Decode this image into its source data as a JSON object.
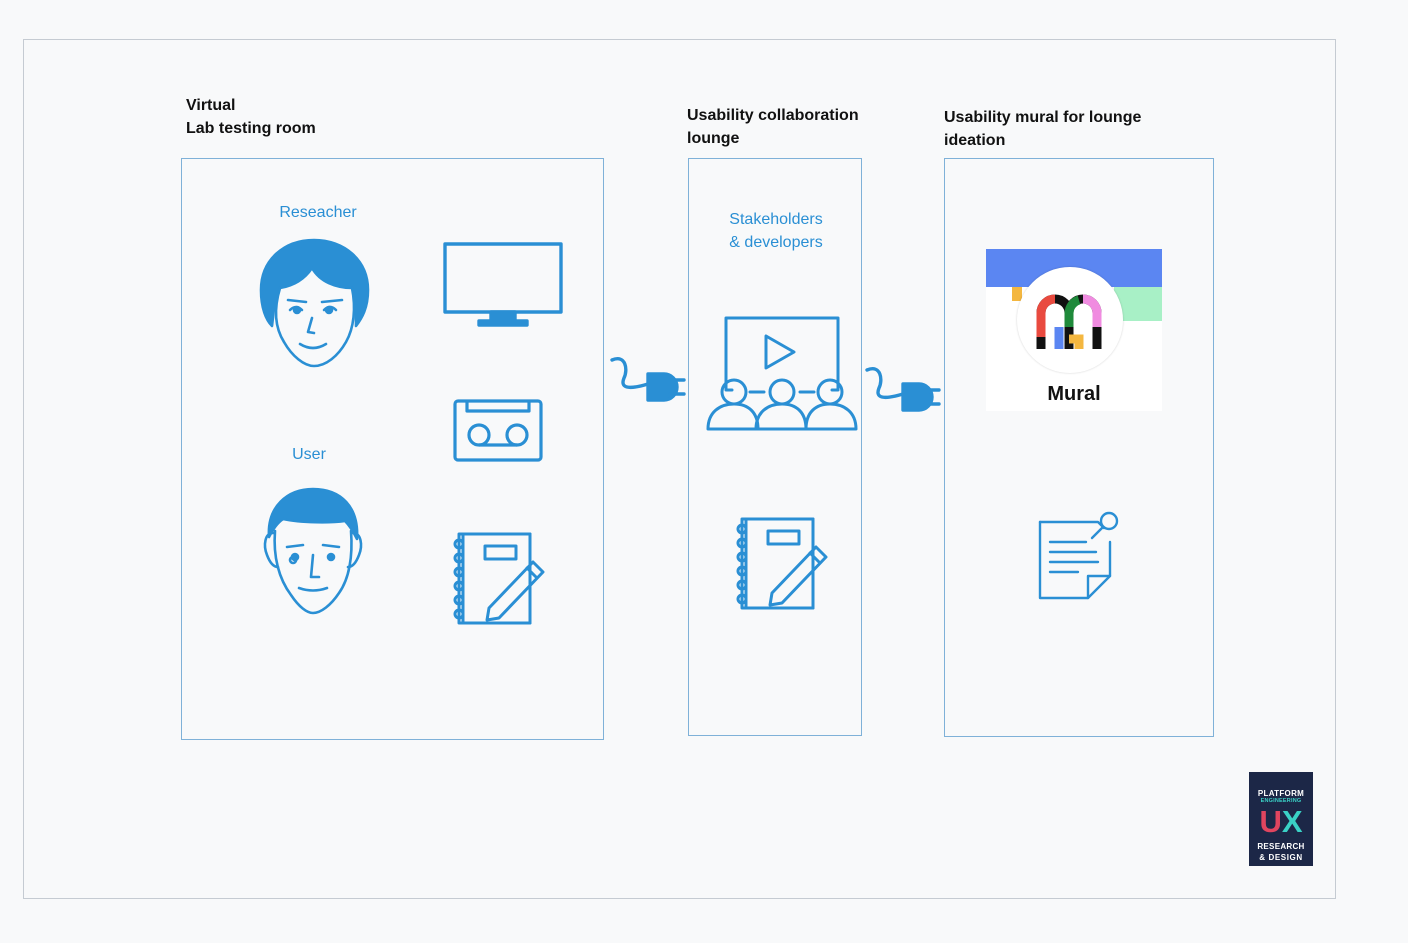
{
  "colors": {
    "icon_blue": "#2a8fd4",
    "panel_border": "#7fb1d8",
    "mural_top": "#5b86f2",
    "mural_accent": "#a8f0c6",
    "badge_bg": "#1c2747",
    "badge_u": "#e0455f",
    "badge_x": "#3ad1c6"
  },
  "sections": {
    "lab": {
      "title_line1": "Virtual",
      "title_line2": "Lab testing room",
      "researcher_label": "Reseacher",
      "user_label": "User"
    },
    "lounge": {
      "title_line1": "Usability collaboration",
      "title_line2": "lounge",
      "stakeholders_line1": "Stakeholders",
      "stakeholders_line2": "& developers"
    },
    "mural": {
      "title_line1": "Usability mural for lounge",
      "title_line2": "ideation",
      "brand_name": "Mural"
    }
  },
  "icons": {
    "researcher": "woman-face-icon",
    "user": "man-face-icon",
    "monitor": "monitor-icon",
    "cassette": "cassette-tape-icon",
    "notebook": "notebook-pencil-icon",
    "plug": "plug-connector-icon",
    "presentation": "video-presentation-audience-icon",
    "note": "sticky-note-pin-icon"
  },
  "logo": {
    "line1": "PLATFORM",
    "line2": "ENGINEERING",
    "mark_u": "U",
    "mark_x": "X",
    "line3": "RESEARCH",
    "line4": "& DESIGN"
  }
}
